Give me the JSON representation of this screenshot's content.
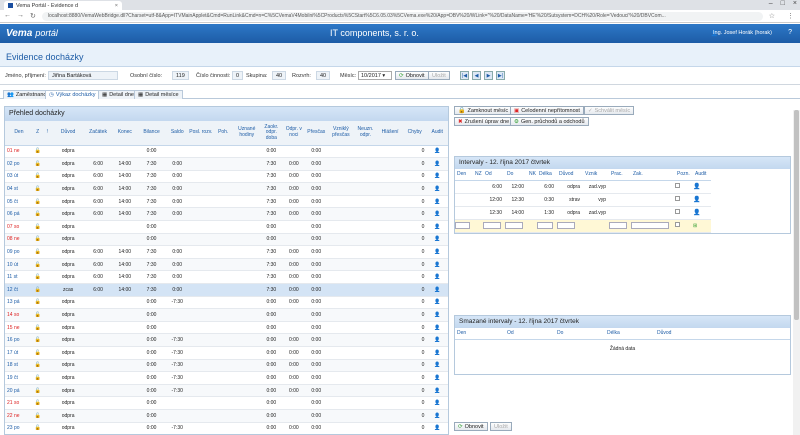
{
  "browser": {
    "tab_title": "Vema Portál - Evidence d",
    "url": "localhost:8880/VemaWebBridge.dll?Charset=utf-8&App=ITVMainApplet&Cmd=RunLink&Cmd=n=C%5CVemaV4Mobilni%5CProducts%5CStart%5C6.05.03%5CVema.exe%20/App=DBV%20/WLink=''%20/DataName='HE'%20/Sutsystem=DCH%20/Role='Vedouci'%20/DBVCom..."
  },
  "app": {
    "logo": "Vema",
    "logo_suffix": "portál",
    "company": "IT components, s. r. o.",
    "user": "Ing. Josef Horák (horak)",
    "page_title": "Evidence docházky"
  },
  "filter": {
    "name_label": "Jméno, příjmení:",
    "name_value": "Jiřina Bartáková",
    "osobni_label": "Osobní číslo:",
    "osobni_value": "119",
    "cislo_label": "Číslo činnosti:",
    "cislo_value": "0",
    "skupina_label": "Skupina:",
    "skupina_value": "40",
    "rozvrh_label": "Rozvrh:",
    "rozvrh_value": "40",
    "mesic_label": "Měsíc:",
    "mesic_value": "10/2017",
    "obnovit": "Obnovit",
    "ulozit": "Uložit"
  },
  "subtabs": [
    "Zaměstnanci",
    "Výkaz docházky",
    "Detail dne",
    "Detail měsíce"
  ],
  "left": {
    "title": "Přehled docházky",
    "headers": [
      "Den",
      "Z",
      "!",
      "Důvod",
      "Začátek",
      "Konec",
      "Bilance",
      "Saldo",
      "Posl. rozv.",
      "Poh.",
      "Uznané hodiny",
      "Zaokr. odpr. doba",
      "Odpr. v noci",
      "Přesčas",
      "Vzniklý přesčas",
      "Neuzn. odpr.",
      "Hlášení",
      "Chyby",
      "Audit"
    ],
    "rows": [
      {
        "den": "01 ne",
        "red": true,
        "duvod": "odpra",
        "zac": "",
        "kon": "",
        "bil": "0:00",
        "sal": "",
        "uzn": "",
        "zao": "0:00",
        "odn": "",
        "pre": "0:00",
        "chy": "0"
      },
      {
        "den": "02 po",
        "red": false,
        "duvod": "odpra",
        "zac": "6:00",
        "kon": "14:00",
        "bil": "7:30",
        "sal": "0:00",
        "uzn": "",
        "zao": "7:30",
        "odn": "0:00",
        "pre": "0:00",
        "chy": "0"
      },
      {
        "den": "03 út",
        "red": false,
        "duvod": "odpra",
        "zac": "6:00",
        "kon": "14:00",
        "bil": "7:30",
        "sal": "0:00",
        "uzn": "",
        "zao": "7:30",
        "odn": "0:00",
        "pre": "0:00",
        "chy": "0"
      },
      {
        "den": "04 st",
        "red": false,
        "duvod": "odpra",
        "zac": "6:00",
        "kon": "14:00",
        "bil": "7:30",
        "sal": "0:00",
        "uzn": "",
        "zao": "7:30",
        "odn": "0:00",
        "pre": "0:00",
        "chy": "0"
      },
      {
        "den": "05 čt",
        "red": false,
        "duvod": "odpra",
        "zac": "6:00",
        "kon": "14:00",
        "bil": "7:30",
        "sal": "0:00",
        "uzn": "",
        "zao": "7:30",
        "odn": "0:00",
        "pre": "0:00",
        "chy": "0"
      },
      {
        "den": "06 pá",
        "red": false,
        "duvod": "odpra",
        "zac": "6:00",
        "kon": "14:00",
        "bil": "7:30",
        "sal": "0:00",
        "uzn": "",
        "zao": "7:30",
        "odn": "0:00",
        "pre": "0:00",
        "chy": "0"
      },
      {
        "den": "07 so",
        "red": true,
        "duvod": "odpra",
        "zac": "",
        "kon": "",
        "bil": "0:00",
        "sal": "",
        "uzn": "",
        "zao": "0:00",
        "odn": "",
        "pre": "0:00",
        "chy": "0"
      },
      {
        "den": "08 ne",
        "red": true,
        "duvod": "odpra",
        "zac": "",
        "kon": "",
        "bil": "0:00",
        "sal": "",
        "uzn": "",
        "zao": "0:00",
        "odn": "",
        "pre": "0:00",
        "chy": "0"
      },
      {
        "den": "09 po",
        "red": false,
        "duvod": "odpra",
        "zac": "6:00",
        "kon": "14:00",
        "bil": "7:30",
        "sal": "0:00",
        "uzn": "",
        "zao": "7:30",
        "odn": "0:00",
        "pre": "0:00",
        "chy": "0"
      },
      {
        "den": "10 út",
        "red": false,
        "duvod": "odpra",
        "zac": "6:00",
        "kon": "14:00",
        "bil": "7:30",
        "sal": "0:00",
        "uzn": "",
        "zao": "7:30",
        "odn": "0:00",
        "pre": "0:00",
        "chy": "0"
      },
      {
        "den": "11 st",
        "red": false,
        "duvod": "odpra",
        "zac": "6:00",
        "kon": "14:00",
        "bil": "7:30",
        "sal": "0:00",
        "uzn": "",
        "zao": "7:30",
        "odn": "0:00",
        "pre": "0:00",
        "chy": "0"
      },
      {
        "den": "12 čt",
        "red": false,
        "hl": true,
        "duvod": "zcas",
        "zac": "6:00",
        "kon": "14:00",
        "bil": "7:30",
        "sal": "0:00",
        "uzn": "",
        "zao": "7:30",
        "odn": "0:00",
        "pre": "0:00",
        "chy": "0"
      },
      {
        "den": "13 pá",
        "red": false,
        "duvod": "odpra",
        "zac": "",
        "kon": "",
        "bil": "0:00",
        "sal": "-7:30",
        "uzn": "",
        "zao": "0:00",
        "odn": "0:00",
        "pre": "0:00",
        "chy": "0"
      },
      {
        "den": "14 so",
        "red": true,
        "duvod": "odpra",
        "zac": "",
        "kon": "",
        "bil": "0:00",
        "sal": "",
        "uzn": "",
        "zao": "0:00",
        "odn": "",
        "pre": "0:00",
        "chy": "0"
      },
      {
        "den": "15 ne",
        "red": true,
        "duvod": "odpra",
        "zac": "",
        "kon": "",
        "bil": "0:00",
        "sal": "",
        "uzn": "",
        "zao": "0:00",
        "odn": "",
        "pre": "0:00",
        "chy": "0"
      },
      {
        "den": "16 po",
        "red": false,
        "duvod": "odpra",
        "zac": "",
        "kon": "",
        "bil": "0:00",
        "sal": "-7:30",
        "uzn": "",
        "zao": "0:00",
        "odn": "0:00",
        "pre": "0:00",
        "chy": "0"
      },
      {
        "den": "17 út",
        "red": false,
        "duvod": "odpra",
        "zac": "",
        "kon": "",
        "bil": "0:00",
        "sal": "-7:30",
        "uzn": "",
        "zao": "0:00",
        "odn": "0:00",
        "pre": "0:00",
        "chy": "0"
      },
      {
        "den": "18 st",
        "red": false,
        "duvod": "odpra",
        "zac": "",
        "kon": "",
        "bil": "0:00",
        "sal": "-7:30",
        "uzn": "",
        "zao": "0:00",
        "odn": "0:00",
        "pre": "0:00",
        "chy": "0"
      },
      {
        "den": "19 čt",
        "red": false,
        "duvod": "odpra",
        "zac": "",
        "kon": "",
        "bil": "0:00",
        "sal": "-7:30",
        "uzn": "",
        "zao": "0:00",
        "odn": "0:00",
        "pre": "0:00",
        "chy": "0"
      },
      {
        "den": "20 pá",
        "red": false,
        "duvod": "odpra",
        "zac": "",
        "kon": "",
        "bil": "0:00",
        "sal": "-7:30",
        "uzn": "",
        "zao": "0:00",
        "odn": "0:00",
        "pre": "0:00",
        "chy": "0"
      },
      {
        "den": "21 so",
        "red": true,
        "duvod": "odpra",
        "zac": "",
        "kon": "",
        "bil": "0:00",
        "sal": "",
        "uzn": "",
        "zao": "0:00",
        "odn": "",
        "pre": "0:00",
        "chy": "0"
      },
      {
        "den": "22 ne",
        "red": true,
        "duvod": "odpra",
        "zac": "",
        "kon": "",
        "bil": "0:00",
        "sal": "",
        "uzn": "",
        "zao": "0:00",
        "odn": "",
        "pre": "0:00",
        "chy": "0"
      },
      {
        "den": "23 po",
        "red": false,
        "duvod": "odpra",
        "zac": "",
        "kon": "",
        "bil": "0:00",
        "sal": "-7:30",
        "uzn": "",
        "zao": "0:00",
        "odn": "0:00",
        "pre": "0:00",
        "chy": "0"
      }
    ]
  },
  "right": {
    "buttons": [
      "Zamknout měsíc",
      "Celodenní nepřítomnost",
      "Schválit měsíc",
      "Zrušení úprav dne",
      "Gen. průchodů a odchodů"
    ],
    "intervals_title": "Intervaly - 12. října 2017 čtvrtek",
    "int_headers": [
      "Den",
      "NZ",
      "Od",
      "Do",
      "NK",
      "Délka",
      "Důvod",
      "Vznik",
      "Prac.",
      "Zak.",
      "Pozn.",
      "Audit"
    ],
    "int_rows": [
      {
        "od": "6:00",
        "do": "12:00",
        "del": "6:00",
        "duv": "odpra",
        "vzn": "zad.vyp"
      },
      {
        "od": "12:00",
        "do": "12:30",
        "del": "0:30",
        "duv": "strav",
        "vzn": "vyp"
      },
      {
        "od": "12:30",
        "do": "14:00",
        "del": "1:30",
        "duv": "odpra",
        "vzn": "zad.vyp"
      }
    ],
    "deleted_title": "Smazané intervaly - 12. října 2017 čtvrtek",
    "del_headers": [
      "Den",
      "Od",
      "Do",
      "Délka",
      "Důvod"
    ],
    "no_data": "Žádná data",
    "obnovit": "Obnovit",
    "ulozit": "Uložit"
  }
}
